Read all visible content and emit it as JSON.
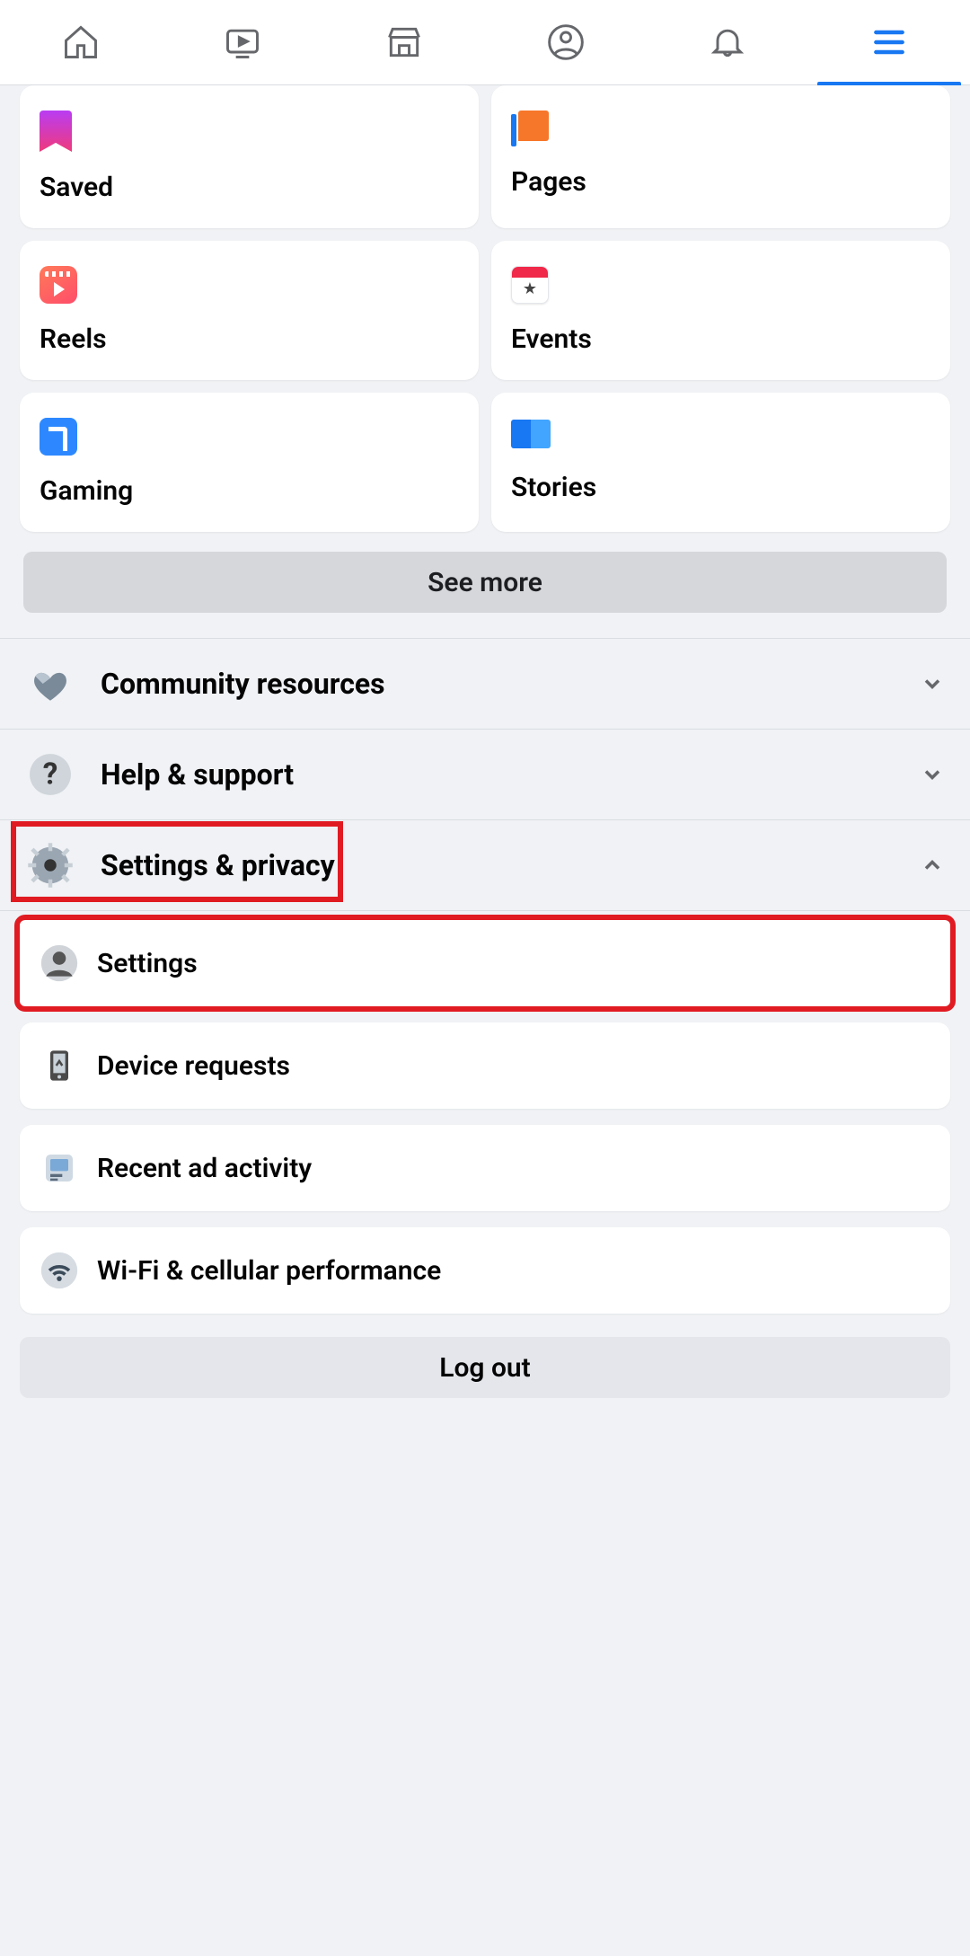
{
  "shortcuts": {
    "saved": "Saved",
    "pages": "Pages",
    "reels": "Reels",
    "events": "Events",
    "gaming": "Gaming",
    "stories": "Stories"
  },
  "buttons": {
    "see_more": "See more",
    "log_out": "Log out"
  },
  "sections": {
    "community": "Community resources",
    "help": "Help & support",
    "settings_privacy": "Settings & privacy"
  },
  "settings_items": {
    "settings": "Settings",
    "device_requests": "Device requests",
    "recent_ad": "Recent ad activity",
    "wifi": "Wi-Fi & cellular performance"
  }
}
